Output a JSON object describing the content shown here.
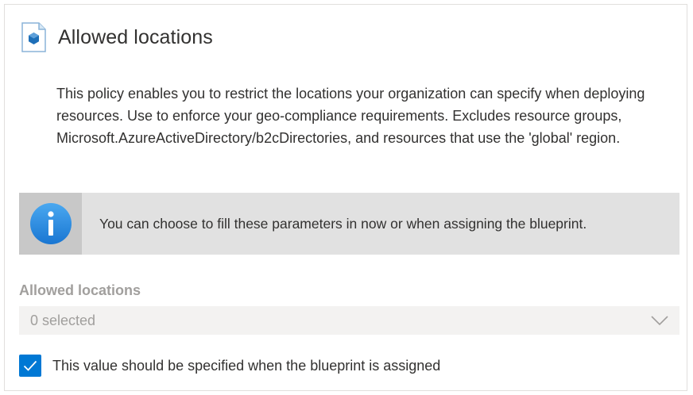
{
  "header": {
    "title": "Allowed locations",
    "icon": "policy-icon"
  },
  "description": "This policy enables you to restrict the locations your organization can specify when deploying resources. Use to enforce your geo-compliance requirements. Excludes resource groups, Microsoft.AzureActiveDirectory/b2cDirectories, and resources that use the 'global' region.",
  "info_bar": {
    "icon": "info-icon",
    "message": "You can choose to fill these parameters in now or when assigning the blueprint."
  },
  "parameter": {
    "label": "Allowed locations",
    "dropdown_value": "0 selected",
    "disabled": true
  },
  "checkbox": {
    "label": "This value should be specified when the blueprint is assigned",
    "checked": true
  },
  "colors": {
    "accent": "#0078d4",
    "info_icon": "#1e88e5",
    "disabled_text": "#a19f9d",
    "info_bar_bg": "#e1e1e1"
  }
}
